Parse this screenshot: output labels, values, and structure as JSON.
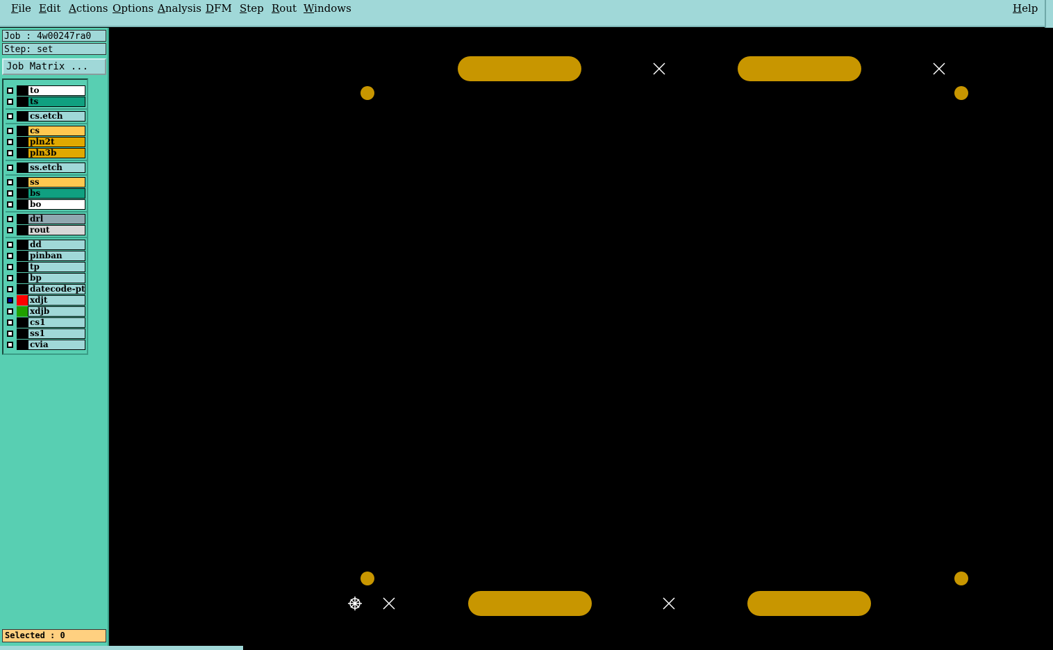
{
  "menubar": {
    "items": [
      "File",
      "Edit",
      "Actions",
      "Options",
      "Analysis",
      "DFM",
      "Step",
      "Rout",
      "Windows"
    ],
    "help": "Help"
  },
  "job": {
    "job_label": "Job : 4w00247ra0",
    "step_label": "Step: set",
    "job_matrix_button": "Job Matrix ..."
  },
  "layers": [
    {
      "name": "to",
      "bg": "#ffffff"
    },
    {
      "name": "ts",
      "bg": "#10a080"
    },
    {
      "name": "cs.etch",
      "bg": "#a0d8d8"
    },
    {
      "name": "cs",
      "bg": "#ffc850"
    },
    {
      "name": "pln2t",
      "bg": "#e0a800"
    },
    {
      "name": "pln3b",
      "bg": "#e0a800"
    },
    {
      "name": "ss.etch",
      "bg": "#a0d8d8"
    },
    {
      "name": "ss",
      "bg": "#ffc850"
    },
    {
      "name": "bs",
      "bg": "#10a080"
    },
    {
      "name": "bo",
      "bg": "#ffffff"
    },
    {
      "name": "drl",
      "bg": "#90a8b0"
    },
    {
      "name": "rout",
      "bg": "#d8d8d8"
    },
    {
      "name": "dd",
      "bg": "#a0d8d8"
    },
    {
      "name": "pinban",
      "bg": "#a0d8d8"
    },
    {
      "name": "tp",
      "bg": "#a0d8d8"
    },
    {
      "name": "bp",
      "bg": "#a0d8d8"
    },
    {
      "name": "datecode-ptc",
      "bg": "#a0d8d8"
    },
    {
      "name": "xdjt",
      "bg": "#a0d8d8",
      "color_swatch": "#ff0000",
      "active": true
    },
    {
      "name": "xdjb",
      "bg": "#a0d8d8",
      "color_swatch": "#20a000"
    },
    {
      "name": "cs1",
      "bg": "#a0d8d8"
    },
    {
      "name": "ss1",
      "bg": "#a0d8d8"
    },
    {
      "name": "cvia",
      "bg": "#a0d8d8"
    }
  ],
  "status": {
    "selected": "Selected : 0"
  },
  "colors": {
    "feature": "#c89600",
    "menu_bg": "#a0d8d8",
    "panel_bg": "#58cfb2"
  }
}
